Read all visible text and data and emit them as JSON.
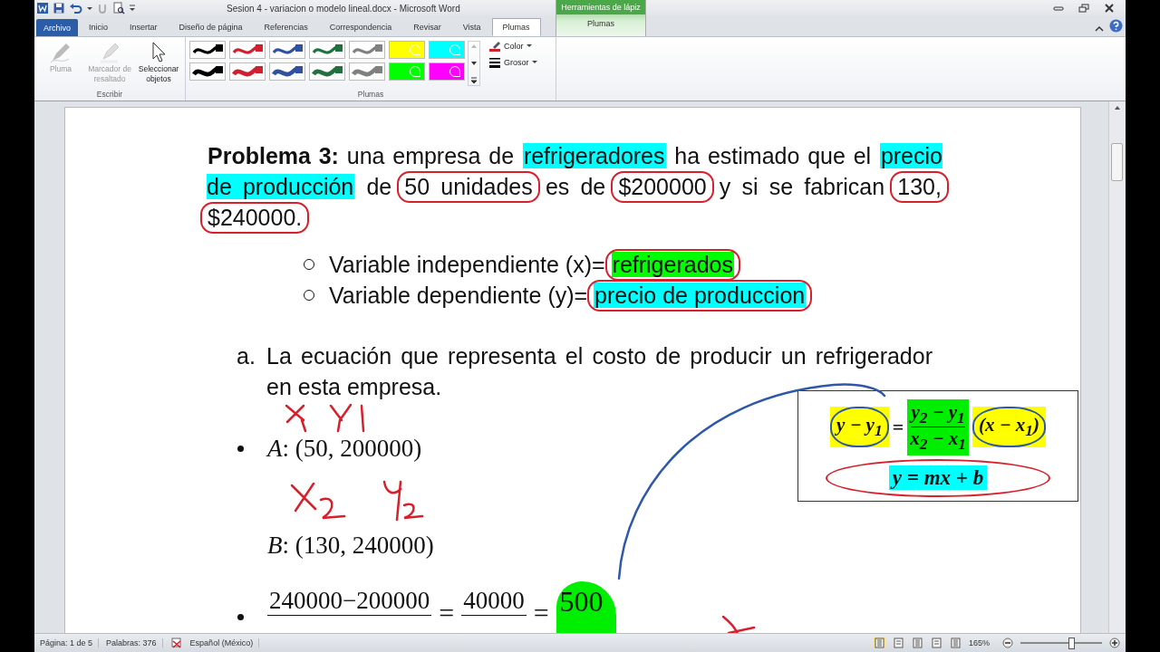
{
  "window": {
    "title": "Sesion 4 - variacion o modelo lineal.docx  -  Microsoft Word"
  },
  "context_group": {
    "title": "Herramientas de lápiz",
    "tab": "Plumas"
  },
  "file_tab": "Archivo",
  "tabs": [
    {
      "label": "Inicio",
      "selected": false
    },
    {
      "label": "Insertar",
      "selected": false
    },
    {
      "label": "Diseño de página",
      "selected": false
    },
    {
      "label": "Referencias",
      "selected": false
    },
    {
      "label": "Correspondencia",
      "selected": false
    },
    {
      "label": "Revisar",
      "selected": false
    },
    {
      "label": "Vista",
      "selected": false
    },
    {
      "label": "Plumas",
      "selected": true
    }
  ],
  "ribbon": {
    "groups": [
      {
        "label": "Escribir",
        "tools": [
          {
            "kind": "pen",
            "label": "Pluma",
            "disabled": true
          },
          {
            "kind": "highlighter",
            "label": "Marcador de resaltado",
            "disabled": true
          },
          {
            "kind": "select",
            "label": "Seleccionar objetos",
            "disabled": false
          }
        ]
      },
      {
        "label": "Plumas",
        "pens": [
          {
            "kind": "thin",
            "color": "#000000"
          },
          {
            "kind": "thin",
            "color": "#d02030"
          },
          {
            "kind": "thin",
            "color": "#3050a0"
          },
          {
            "kind": "thin",
            "color": "#207040"
          },
          {
            "kind": "thin",
            "color": "#808080"
          },
          {
            "kind": "highlighter",
            "color": "#ffff00"
          },
          {
            "kind": "highlighter",
            "color": "#00ffff"
          },
          {
            "kind": "thick",
            "color": "#000000"
          },
          {
            "kind": "thick",
            "color": "#d02030"
          },
          {
            "kind": "thick",
            "color": "#3050a0"
          },
          {
            "kind": "thick",
            "color": "#207040"
          },
          {
            "kind": "thick",
            "color": "#808080"
          },
          {
            "kind": "highlighter",
            "color": "#00ff00"
          },
          {
            "kind": "highlighter",
            "color": "#ff00ff"
          }
        ],
        "options": [
          "Color",
          "Grosor"
        ]
      }
    ]
  },
  "document": {
    "problem": [
      {
        "text": "**Problema 3:** una empresa de ",
        "circled": false
      },
      {
        "text": "refrigeradores",
        "color": "#00ffff",
        "circled": false
      },
      {
        "text": " ha estimado que el ",
        "circled": false
      },
      {
        "text": "precio de producción",
        "color": "#00ffff",
        "circled": false
      },
      {
        "text": " de ",
        "circled": false
      },
      {
        "text": "50 unidades",
        "circled": true
      },
      {
        "text": " es de ",
        "circled": false
      },
      {
        "text": "$200000",
        "circled": true
      },
      {
        "text": " y si se fabrican ",
        "circled": false
      },
      {
        "text": "130, ",
        "circled": true
      },
      {
        "text": "$240000.",
        "circled": true
      }
    ],
    "variables": [
      {
        "text": "Variable independiente (x)= ",
        "answer": "refrigerados",
        "color": "#00ff00",
        "circled": true
      },
      {
        "text": "Variable dependiente (y)= ",
        "answer": "precio de produccion",
        "color": "#00ffff",
        "circled": true
      }
    ],
    "question": {
      "marker": "a.",
      "text": "La ecuación que representa el costo de producir un refrigerador en esta empresa."
    },
    "points": [
      {
        "label": "A",
        "value": ": (50, 200000)"
      },
      {
        "label": "B",
        "value": ": (130, 240000)"
      }
    ],
    "slope": {
      "numerator_1": "240000−200000",
      "equals_1": "=",
      "numerator_2": "40000",
      "equals_2": "=",
      "result": "500"
    },
    "formula_box": {
      "lhs": "y − y$_{1}$",
      "equals": "=",
      "numerator": "y$_{2}$ − y$_{1}$",
      "denominator": "x$_{2}$ − x$_{1}$",
      "factor": "(x − x$_{1}$)",
      "line": "y = mx + b",
      "lhs_circled": true,
      "factor_circled": true,
      "line_circled": true
    }
  },
  "status_bar": {
    "page": "Página: 1 de 5",
    "words": "Palabras: 376",
    "language": "Español (México)",
    "zoom": "165%",
    "zoom_level": {
      "level": 0.62
    }
  }
}
